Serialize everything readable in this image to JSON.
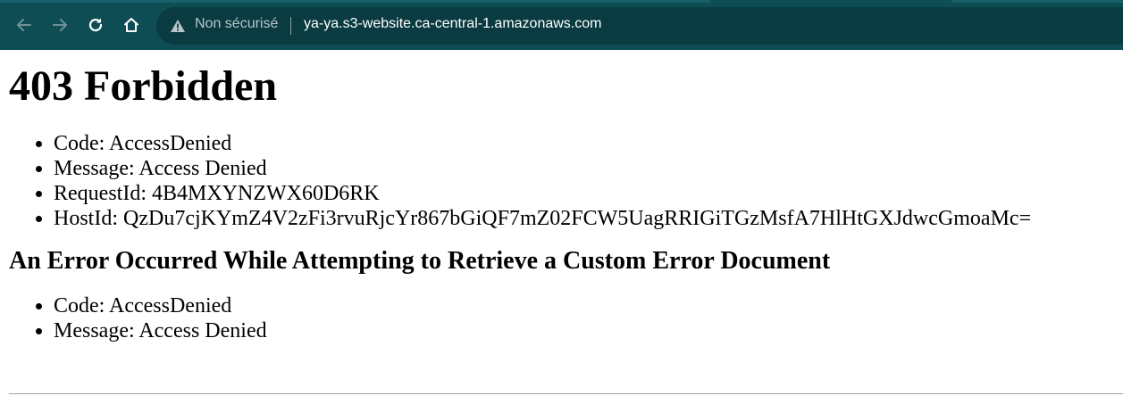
{
  "browser": {
    "security_label": "Non sécurisé",
    "url": "ya-ya.s3-website.ca-central-1.amazonaws.com",
    "icons": {
      "back": "arrow-left-icon",
      "forward": "arrow-right-icon",
      "reload": "reload-icon",
      "home": "home-icon",
      "security": "warning-triangle-icon"
    },
    "colors": {
      "toolbar": "#0f4d55",
      "omnibox": "#0a3b41"
    }
  },
  "page": {
    "heading": "403 Forbidden",
    "details": [
      "Code: AccessDenied",
      "Message: Access Denied",
      "RequestId: 4B4MXYNZWX60D6RK",
      "HostId: QzDu7cjKYmZ4V2zFi3rvuRjcYr867bGiQF7mZ02FCW5UagRRIGiTGzMsfA7HlHtGXJdwcGmoaMc="
    ],
    "subheading": "An Error Occurred While Attempting to Retrieve a Custom Error Document",
    "subdetails": [
      "Code: AccessDenied",
      "Message: Access Denied"
    ]
  }
}
